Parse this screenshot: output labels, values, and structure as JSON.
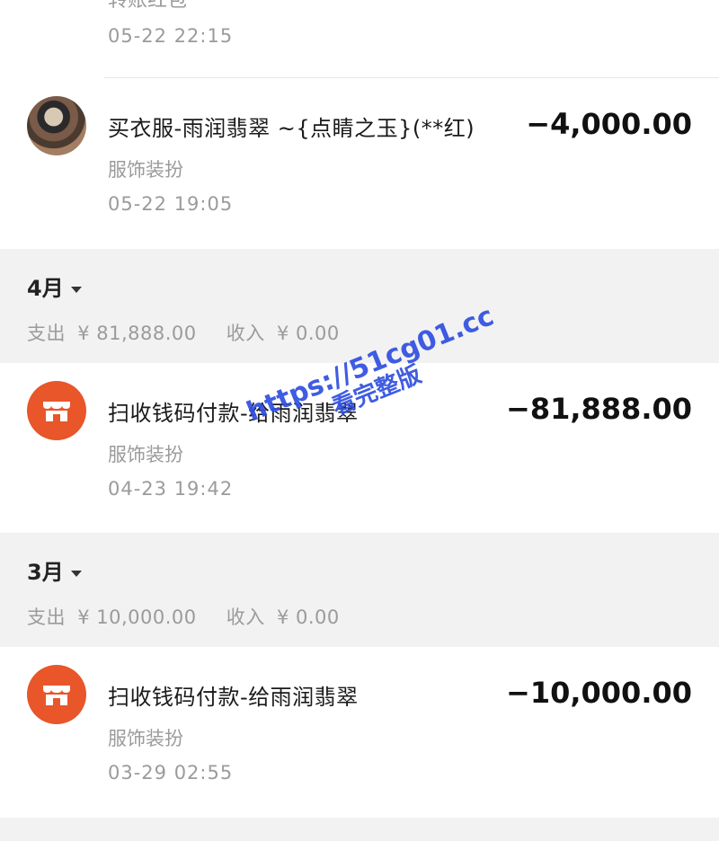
{
  "top_cut": {
    "label": "转账红包",
    "time": "05-22  22:15"
  },
  "transactions_may": [
    {
      "title": "买衣服-雨润翡翠 ~{点睛之玉}(**红)",
      "amount": "−4,000.00",
      "category": "服饰装扮",
      "time": "05-22  19:05",
      "avatar": "user-photo-avatar"
    }
  ],
  "april": {
    "month": "4月",
    "summary_expense_label": "支出",
    "summary_expense_value": "¥ 81,888.00",
    "summary_income_label": "收入",
    "summary_income_value": "¥ 0.00",
    "transaction": {
      "title": "扫收钱码付款-给雨润翡翠",
      "amount": "−81,888.00",
      "category": "服饰装扮",
      "time": "04-23  19:42",
      "avatar": "shop-icon"
    }
  },
  "march": {
    "month": "3月",
    "summary_expense_label": "支出",
    "summary_expense_value": "¥ 10,000.00",
    "summary_income_label": "收入",
    "summary_income_value": "¥ 0.00",
    "transaction": {
      "title": "扫收钱码付款-给雨润翡翠",
      "amount": "−10,000.00",
      "category": "服饰装扮",
      "time": "03-29  02:55",
      "avatar": "shop-icon"
    }
  },
  "watermark": {
    "line1": "https://51cg01.cc",
    "line2": "看完整版"
  },
  "colors": {
    "shop_icon_bg": "#e8562a",
    "section_bg": "#f2f2f2",
    "watermark": "#2f4fe0"
  }
}
